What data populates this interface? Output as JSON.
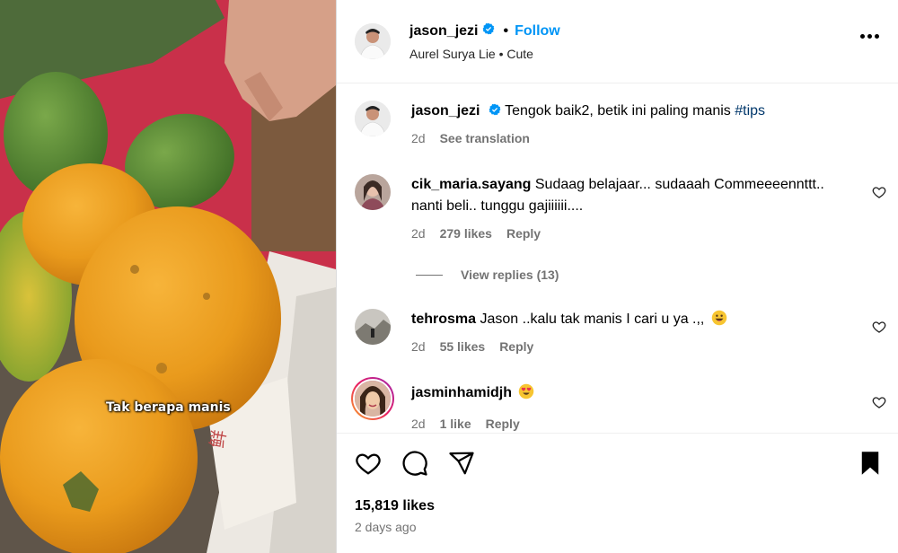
{
  "media": {
    "overlay_text": "Tak berapa manis"
  },
  "post": {
    "author": "jason_jezi",
    "follow_label": "Follow",
    "audio": "Aurel Surya Lie • Cute",
    "caption_text": "Tengok baik2, betik ini paling manis",
    "caption_hashtag": "#tips",
    "caption_time": "2d",
    "see_translation": "See translation",
    "likes": "15,819 likes",
    "posted": "2 days ago"
  },
  "comments": [
    {
      "user": "cik_maria.sayang",
      "text": "Sudaag belajaar... sudaaah Commeeeennttt.. nanti beli.. tunggu gajiiiiii....",
      "time": "2d",
      "likes": "279 likes",
      "reply": "Reply",
      "view_replies": "View replies (13)"
    },
    {
      "user": "tehrosma",
      "text": "Jason ..kalu tak manis I cari u ya .,,",
      "time": "2d",
      "likes": "55 likes",
      "reply": "Reply"
    },
    {
      "user": "jasminhamidjh",
      "text": "",
      "time": "2d",
      "likes": "1 like",
      "reply": "Reply"
    }
  ],
  "icons": {
    "verified": "verified-badge-icon",
    "more": "more-options-icon",
    "like": "heart-icon",
    "comment": "comment-icon",
    "share": "share-icon",
    "save": "bookmark-icon"
  },
  "colors": {
    "accent": "#0095f6",
    "hashtag": "#00376b",
    "muted": "#737373"
  }
}
